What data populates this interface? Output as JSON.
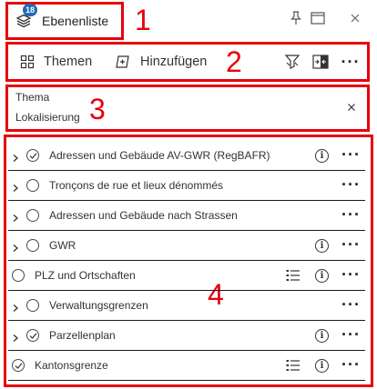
{
  "header": {
    "title": "Ebenenliste",
    "badge_count": "18"
  },
  "toolbar": {
    "themes_label": "Themen",
    "add_label": "Hinzufügen"
  },
  "filter": {
    "theme_label": "Thema",
    "localization_label": "Lokalisierung"
  },
  "annotations": [
    "1",
    "2",
    "3",
    "4"
  ],
  "layers": [
    {
      "label": "Adressen und Gebäude AV-GWR (RegBAFR)",
      "expandable": true,
      "checked": true,
      "legend": false,
      "info": true
    },
    {
      "label": "Tronçons de rue et lieux dénommés",
      "expandable": true,
      "checked": false,
      "legend": false,
      "info": false
    },
    {
      "label": "Adressen und Gebäude nach Strassen",
      "expandable": true,
      "checked": false,
      "legend": false,
      "info": false
    },
    {
      "label": "GWR",
      "expandable": true,
      "checked": false,
      "legend": false,
      "info": true
    },
    {
      "label": "PLZ und Ortschaften",
      "expandable": false,
      "checked": false,
      "legend": true,
      "info": true
    },
    {
      "label": "Verwaltungsgrenzen",
      "expandable": true,
      "checked": false,
      "legend": false,
      "info": false
    },
    {
      "label": "Parzellenplan",
      "expandable": true,
      "checked": true,
      "legend": false,
      "info": true
    },
    {
      "label": "Kantonsgrenze",
      "expandable": false,
      "checked": true,
      "legend": true,
      "info": true
    }
  ],
  "colors": {
    "annotation_red": "#e8000b",
    "badge_blue": "#1f6bb5",
    "text": "#323232"
  }
}
